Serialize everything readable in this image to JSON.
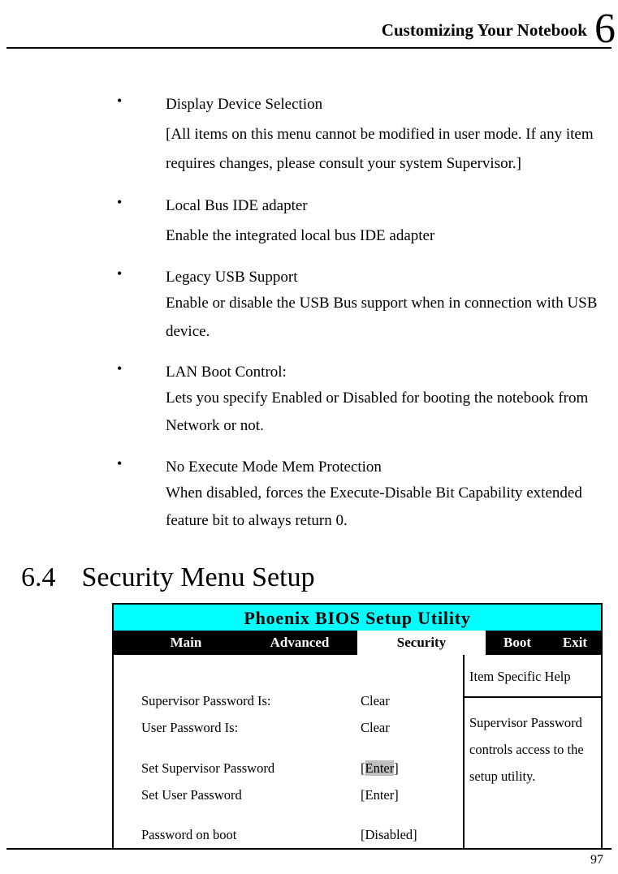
{
  "chapter": {
    "running_head": "Customizing Your Notebook",
    "number": "6"
  },
  "items": [
    {
      "title": "Display Device Selection",
      "sub": "[All items on this menu cannot be modified in user mode. If any item requires changes, please consult your system Supervisor.]"
    },
    {
      "title": "Local Bus IDE adapter",
      "sub": "Enable the integrated local bus IDE adapter"
    },
    {
      "title": "Legacy USB Support",
      "sub": "Enable or disable the USB Bus support when in connection with USB device."
    },
    {
      "title": "LAN Boot Control:",
      "sub": "Lets you specify Enabled or Disabled for booting the notebook from Network or not."
    },
    {
      "title": "No Execute Mode Mem Protection",
      "sub": "When disabled, forces the Execute-Disable Bit Capability extended feature bit to always return 0."
    }
  ],
  "section": {
    "num": "6.4",
    "title": "Security Menu Setup"
  },
  "bios": {
    "title": "Phoenix BIOS Setup Utility",
    "tabs": {
      "main": "Main",
      "advanced": "Advanced",
      "security": "Security",
      "boot": "Boot",
      "exit": "Exit"
    },
    "rows": {
      "sup_pw_label": "Supervisor Password Is:",
      "sup_pw_val": "Clear",
      "user_pw_label": "User Password Is:",
      "user_pw_val": "Clear",
      "set_sup_label": "Set Supervisor Password",
      "set_sup_val_pre": "[",
      "set_sup_val_mid": "Enter",
      "set_sup_val_post": "]",
      "set_user_label": "Set User Password",
      "set_user_val": "[Enter]",
      "pw_boot_label": "Password on boot",
      "pw_boot_val": "[Disabled]"
    },
    "help": {
      "title": "Item Specific Help",
      "body": "Supervisor Password controls access to the setup utility."
    }
  },
  "page_number": "97"
}
